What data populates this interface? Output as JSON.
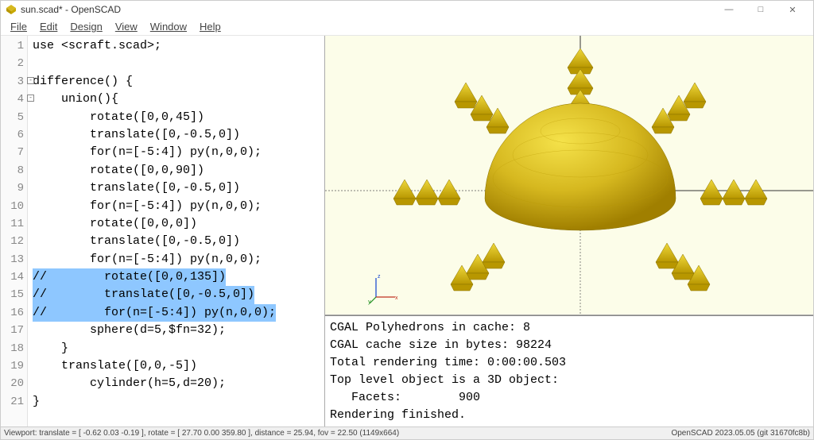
{
  "window": {
    "title": "sun.scad* - OpenSCAD"
  },
  "menubar": {
    "file": "File",
    "edit": "Edit",
    "design": "Design",
    "view": "View",
    "window": "Window",
    "help": "Help"
  },
  "editor": {
    "lines": [
      "use <scraft.scad>;",
      "",
      "difference() {",
      "    union(){",
      "        rotate([0,0,45])",
      "        translate([0,-0.5,0])",
      "        for(n=[-5:4]) py(n,0,0);",
      "        rotate([0,0,90])",
      "        translate([0,-0.5,0])",
      "        for(n=[-5:4]) py(n,0,0);",
      "        rotate([0,0,0])",
      "        translate([0,-0.5,0])",
      "        for(n=[-5:4]) py(n,0,0);",
      "//        rotate([0,0,135])",
      "//        translate([0,-0.5,0])",
      "//        for(n=[-5:4]) py(n,0,0);",
      "        sphere(d=5,$fn=32);",
      "    }",
      "    translate([0,0,-5])",
      "        cylinder(h=5,d=20);",
      "}"
    ],
    "selection_start": 14,
    "selection_end": 16
  },
  "console": {
    "lines": [
      "CGAL Polyhedrons in cache: 8",
      "CGAL cache size in bytes: 98224",
      "Total rendering time: 0:00:00.503",
      "Top level object is a 3D object:",
      "   Facets:        900",
      "Rendering finished."
    ]
  },
  "statusbar": {
    "left": "Viewport: translate = [ -0.62 0.03 -0.19 ], rotate = [ 27.70 0.00 359.80 ], distance = 25.94, fov = 22.50 (1149x664)",
    "right": "OpenSCAD 2023.05.05 (git 31670fc8b)"
  },
  "axes": {
    "x": "x",
    "y": "y",
    "z": "z"
  },
  "colors": {
    "model": "#d6b81f",
    "model_dark": "#b89700",
    "viewport_bg": "#fcfde9"
  }
}
